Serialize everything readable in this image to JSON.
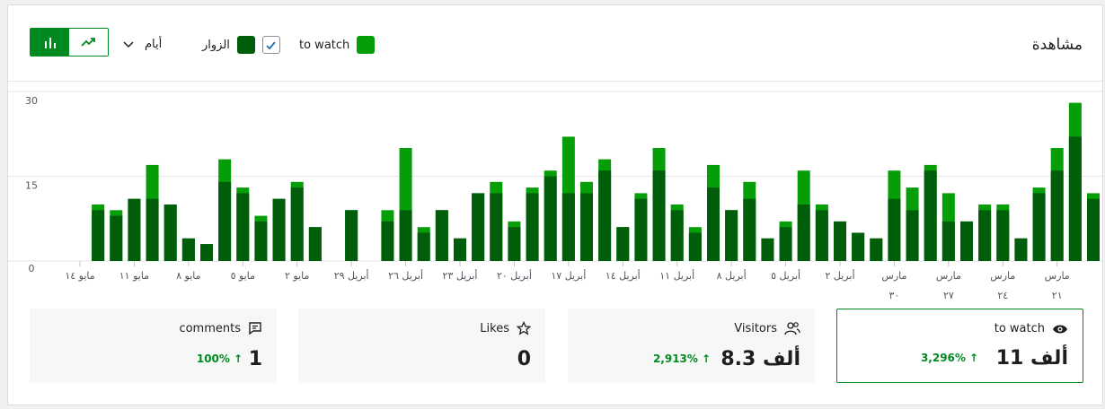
{
  "header": {
    "title": "مشاهدة",
    "legend": [
      {
        "label": "to watch",
        "color": "#069e08"
      },
      {
        "label": "الزوار",
        "color": "#005e0a",
        "checked": true
      }
    ],
    "period_label": "أيام"
  },
  "colors": {
    "accent": "#008a20",
    "views": "#069e08",
    "visitors": "#005e0a"
  },
  "chart_data": {
    "type": "bar",
    "ylim": [
      0,
      30
    ],
    "yticks": [
      "30",
      "15",
      "0"
    ],
    "series": [
      {
        "name": "to watch",
        "values": [
          0,
          10,
          9,
          11,
          17,
          10,
          4,
          3,
          18,
          13,
          8,
          11,
          14,
          6,
          0,
          9,
          0,
          9,
          20,
          6,
          9,
          4,
          12,
          14,
          7,
          13,
          16,
          22,
          14,
          18,
          6,
          12,
          20,
          10,
          6,
          17,
          9,
          14,
          4,
          7,
          16,
          10,
          7,
          5,
          4,
          16,
          13,
          17,
          12,
          7,
          10,
          10,
          4,
          13,
          20,
          28,
          12
        ]
      },
      {
        "name": "الزوار",
        "values": [
          0,
          9,
          8,
          11,
          11,
          10,
          4,
          3,
          14,
          12,
          7,
          11,
          13,
          6,
          0,
          9,
          0,
          7,
          9,
          5,
          9,
          4,
          12,
          12,
          6,
          12,
          15,
          12,
          12,
          16,
          6,
          11,
          16,
          9,
          5,
          13,
          9,
          11,
          4,
          6,
          10,
          9,
          7,
          5,
          4,
          11,
          9,
          16,
          7,
          7,
          9,
          9,
          4,
          12,
          16,
          22,
          11
        ]
      }
    ],
    "x_labels": [
      {
        "index": 0,
        "lines": [
          "مايو ١٤"
        ]
      },
      {
        "index": 3,
        "lines": [
          "مايو ١١"
        ]
      },
      {
        "index": 6,
        "lines": [
          "مايو ٨"
        ]
      },
      {
        "index": 9,
        "lines": [
          "مايو ٥"
        ]
      },
      {
        "index": 12,
        "lines": [
          "مايو ٢"
        ]
      },
      {
        "index": 15,
        "lines": [
          "أبريل ٢٩"
        ]
      },
      {
        "index": 18,
        "lines": [
          "أبريل ٢٦"
        ]
      },
      {
        "index": 21,
        "lines": [
          "أبريل ٢٣"
        ]
      },
      {
        "index": 24,
        "lines": [
          "أبريل ٢٠"
        ]
      },
      {
        "index": 27,
        "lines": [
          "أبريل ١٧"
        ]
      },
      {
        "index": 30,
        "lines": [
          "أبريل ١٤"
        ]
      },
      {
        "index": 33,
        "lines": [
          "أبريل ١١"
        ]
      },
      {
        "index": 36,
        "lines": [
          "أبريل ٨"
        ]
      },
      {
        "index": 39,
        "lines": [
          "أبريل ٥"
        ]
      },
      {
        "index": 42,
        "lines": [
          "أبريل ٢"
        ]
      },
      {
        "index": 45,
        "lines": [
          "مارس",
          "٣٠"
        ]
      },
      {
        "index": 48,
        "lines": [
          "مارس",
          "٢٧"
        ]
      },
      {
        "index": 51,
        "lines": [
          "مارس",
          "٢٤"
        ]
      },
      {
        "index": 54,
        "lines": [
          "مارس",
          "٢١"
        ]
      }
    ],
    "grid": true
  },
  "stats": [
    {
      "label": "to watch",
      "value": "11 ألف",
      "change": "3,296%",
      "arrow": "↑",
      "icon": "eye-icon",
      "active": true
    },
    {
      "label": "Visitors",
      "value": "8.3 ألف",
      "change": "2,913%",
      "arrow": "↑",
      "icon": "people-icon",
      "active": false
    },
    {
      "label": "Likes",
      "value": "0",
      "change": "",
      "arrow": "",
      "icon": "star-icon",
      "active": false
    },
    {
      "label": "comments",
      "value": "1",
      "change": "100%",
      "arrow": "↑",
      "icon": "comment-icon",
      "active": false
    }
  ]
}
